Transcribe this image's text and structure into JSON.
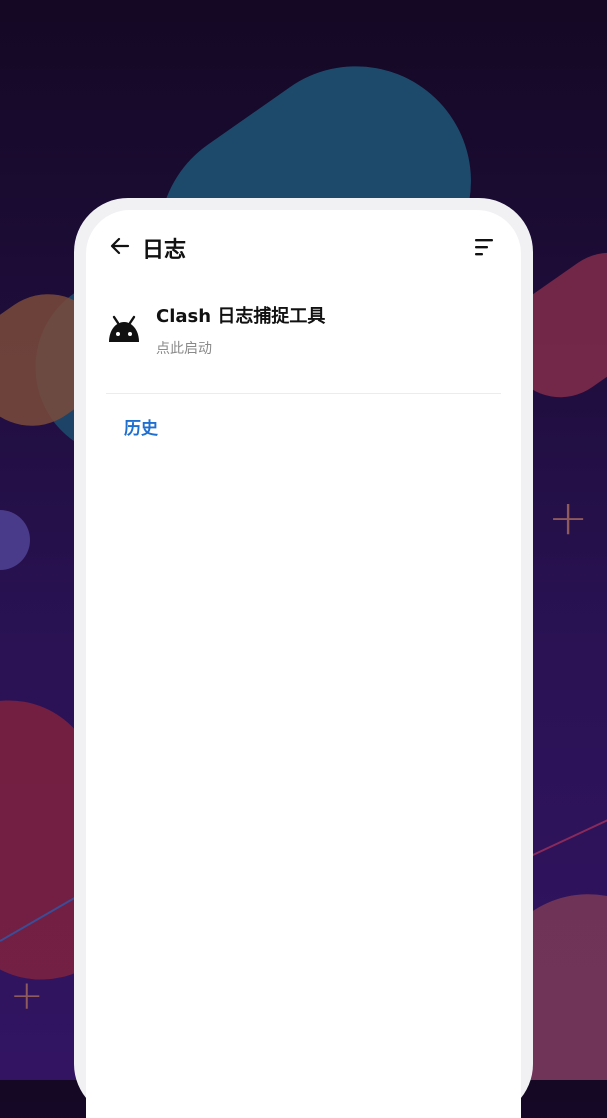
{
  "toolbar": {
    "title": "日志",
    "back_icon": "arrow-left-icon",
    "menu_icon": "sort-icon"
  },
  "log_tool": {
    "icon": "android-icon",
    "title": "Clash 日志捕捉工具",
    "subtitle": "点此启动"
  },
  "section": {
    "history_label": "历史",
    "accent_color": "#1f6fd1"
  }
}
